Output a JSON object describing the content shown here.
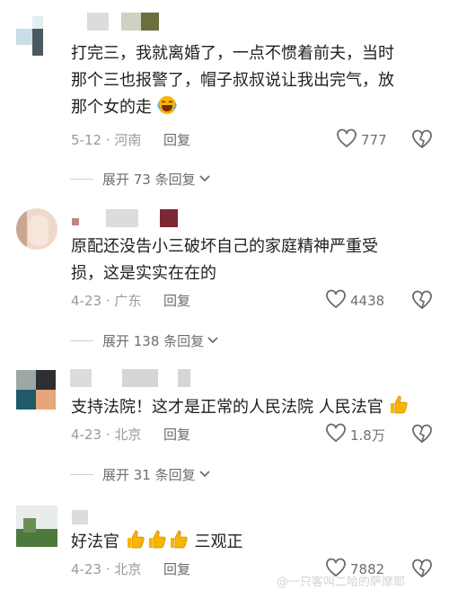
{
  "comments": [
    {
      "text_lines": [
        "打完三，我就离婚了，一点不惯着前夫，当时",
        "那个三也报警了，帽子叔叔说让我出完气，放",
        "那个女的走"
      ],
      "date": "5-12",
      "location": "河南",
      "reply_label": "回复",
      "likes": "777",
      "expand_label": "展开 73 条回复"
    },
    {
      "text_lines": [
        "原配还没告小三破坏自己的家庭精神严重受",
        "损，这是实实在在的"
      ],
      "date": "4-23",
      "location": "广东",
      "reply_label": "回复",
      "likes": "4438",
      "expand_label": "展开 138 条回复"
    },
    {
      "text_lines": [
        "支持法院！这才是正常的人民法院 人民法官"
      ],
      "date": "4-23",
      "location": "北京",
      "reply_label": "回复",
      "likes": "1.8万",
      "expand_label": "展开 31 条回复"
    },
    {
      "text_lines": [
        "好法官",
        "三观正"
      ],
      "date": "4-23",
      "location": "北京",
      "reply_label": "回复",
      "likes": "7882"
    }
  ],
  "icons": {
    "like": "heart-outline-icon",
    "dislike": "broken-heart-icon",
    "expand": "chevron-down-icon",
    "laugh": "laughing-face-emoji",
    "thumbs": "thumbs-up-emoji"
  },
  "watermark": "@一只客叫二哈的萨摩耶",
  "colors": {
    "text": "#1f1f1f",
    "meta": "#9a9a9a",
    "reply": "#6b6b6b",
    "emoji_yellow": "#f7b500"
  }
}
